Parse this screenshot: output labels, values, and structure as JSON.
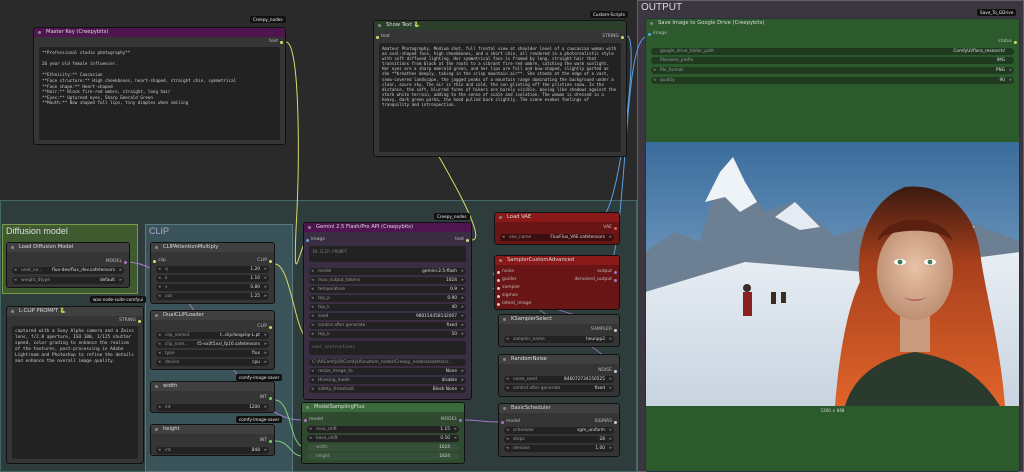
{
  "groups": {
    "output": {
      "title": "OUTPUT"
    },
    "diffusion": {
      "title": "Diffusion model"
    },
    "clip": {
      "title": "CLIP"
    }
  },
  "nodes": {
    "master_key": {
      "title": "Master Key (Creepybits)",
      "badge": "Creepy_nodes",
      "out_label": "text",
      "text": "**Professional studio photography**\n\n26 year old female influencer.\n\n**Ethnicity:** Caucasian\n**Face structure:** High cheekbones, heart-shaped, straight chin, symmetrical\n**Face shape:** Heart-shaped\n**Hair:** Black fire-red ombre, straight, long hair\n**Eyes:** Upturned eyes, Sharp Emerald Green\n**Mouth:** Bow shaped full lips, tiny dimples when smiling"
    },
    "show_text": {
      "title": "Show Text 🐍",
      "badge": "Custom-Scripts",
      "in_label": "text",
      "out_label": "STRING",
      "text": "Amateur Photography, Medium shot, full frontal view at shoulder level of a caucasian woman with an oval-shaped face, high cheekbones, and a short chin, all rendered in a photorealistic style with soft diffused lighting. Her symmetrical face is framed by long, straight hair that transitions from black at the roots to a vibrant fire-red ombre, catching the warm sunlight. Her eyes are a sharp emerald green, and her lips are full and bow-shaped, slightly parted as she **breathes deeply, taking in the crisp mountain air**. She stands at the edge of a vast, snow-covered landscape, the jagged peaks of a mountain range dominating the background under a clear, azure sky. The air is thin and cold, the sun glinting off the pristine snow. In the distance, the soft, blurred forms of hikers are barely visible, moving like shadows against the stark white terrain, adding to the sense of scale and isolation. The woman is dressed in a heavy, dark green parka, the hood pulled back slightly. The scene evokes feelings of tranquility and introspection."
    },
    "save_gdrive": {
      "title": "Save Image to Google Drive (Creepybits)",
      "badge": "Save_To_GDrive",
      "in_label": "image",
      "out_label": "status",
      "widgets": [
        {
          "label": "google_drive_folder_path",
          "value": "ComfyUI/flora_research/"
        },
        {
          "label": "filename_prefix",
          "value": "IMG"
        },
        {
          "label": "file_format",
          "value": "PNG"
        },
        {
          "label": "quality",
          "value": "90"
        }
      ],
      "caption": "1200 × 848"
    },
    "load_diffusion": {
      "title": "Load Diffusion Model",
      "badge": "was-node-suite-comfyui",
      "out_label": "MODEL",
      "widgets": [
        {
          "label": "unet_na...",
          "value": "flux-dev/flux_dev.safetensors"
        },
        {
          "label": "weight_dtype",
          "value": "default"
        }
      ]
    },
    "lclip": {
      "title": "L-CLIP PROMPT 🐍",
      "out_label": "STRING",
      "text": "captured with a Sony Alpha camera and a Zeiss lens, f/2.8 aperture, ISO 100, 1/125 shutter speed, color grading to enhance the realism of the textures, post-processing in Adobe Lightroom and Photoshop to refine the details and enhance the overall image quality."
    },
    "clip_attention": {
      "title": "CLIPAttentionMultiply",
      "in_label": "clip",
      "out_label": "CLIP",
      "widgets": [
        {
          "label": "q",
          "value": "1.20"
        },
        {
          "label": "k",
          "value": "1.10"
        },
        {
          "label": "v",
          "value": "0.80"
        },
        {
          "label": "out",
          "value": "1.25"
        }
      ]
    },
    "dualclip": {
      "title": "DualCLIPLoader",
      "badge": "comfy-image-saver",
      "out_label": "CLIP",
      "widgets": [
        {
          "label": "clip_name1",
          "value": "t..clip/longclip-L.pt"
        },
        {
          "label": "clip_nam...",
          "value": "t5-xxl/t5xxl_fp16.safetensors"
        },
        {
          "label": "type",
          "value": "flux"
        },
        {
          "label": "device",
          "value": "cpu"
        }
      ]
    },
    "width": {
      "title": "width",
      "badge": "comfy-image-saver",
      "out_label": "INT",
      "widgets": [
        {
          "label": "int",
          "value": "1200"
        }
      ]
    },
    "height": {
      "title": "height",
      "out_label": "INT",
      "widgets": [
        {
          "label": "int",
          "value": "848"
        }
      ]
    },
    "gemini": {
      "title": "Gemini 2.5 Flash/Pro API (Creepybits)",
      "badge": "Creepy_nodes",
      "in_label": "image",
      "out_label": "text",
      "input_text": "IN.CLIP.PROMPT",
      "widgets": [
        {
          "label": "model",
          "value": "gemini-2.5-flash"
        },
        {
          "label": "max_output_tokens",
          "value": "1024"
        },
        {
          "label": "temperature",
          "value": "0.9"
        },
        {
          "label": "top_p",
          "value": "0.90"
        },
        {
          "label": "top_k",
          "value": "40"
        },
        {
          "label": "seed",
          "value": "980154458142007"
        },
        {
          "label": "control after generate",
          "value": "fixed"
        },
        {
          "label": "top_k",
          "value": "50"
        }
      ],
      "user_instruction": "user_instructions",
      "path_value": "C:\\AI\\ComfyUI\\ComfyUI\\custom_nodes\\Creepy_nodes\\assets\\scr...",
      "widgets2": [
        {
          "label": "resize_image_to",
          "value": "None"
        },
        {
          "label": "thinking_mode",
          "value": "disable"
        },
        {
          "label": "safety_threshold",
          "value": "Block None"
        }
      ]
    },
    "model_sampling": {
      "title": "ModelSamplingFlux",
      "in_label": "model",
      "out_label": "MODEL",
      "widgets": [
        {
          "label": "max_shift",
          "value": "1.15"
        },
        {
          "label": "base_shift",
          "value": "0.50"
        },
        {
          "label": "width",
          "value": "1024"
        },
        {
          "label": "height",
          "value": "1024"
        }
      ]
    },
    "load_vae": {
      "title": "Load VAE",
      "out_label": "VAE",
      "widgets": [
        {
          "label": "vae_name",
          "value": "FluxFlux_VAE.safetensors"
        }
      ]
    },
    "sampler_custom": {
      "title": "SamplerCustomAdvanced",
      "outs": [
        "output",
        "denoised_output"
      ],
      "ins": [
        "noise",
        "guider",
        "sampler",
        "sigmas",
        "latent_image"
      ]
    },
    "ksampler_select": {
      "title": "KSamplerSelect",
      "out_label": "SAMPLER",
      "widgets": [
        {
          "label": "sampler_name",
          "value": "heunpp2"
        }
      ]
    },
    "random_noise": {
      "title": "RandomNoise",
      "out_label": "NOISE",
      "widgets": [
        {
          "label": "noise_seed",
          "value": "846072734150525"
        },
        {
          "label": "control after generate",
          "value": "fixed"
        }
      ]
    },
    "basic_scheduler": {
      "title": "BasicScheduler",
      "in_label": "model",
      "out_label": "SIGMAS",
      "widgets": [
        {
          "label": "scheduler",
          "value": "sgm_uniform"
        },
        {
          "label": "steps",
          "value": "28"
        },
        {
          "label": "denoise",
          "value": "1.00"
        }
      ]
    }
  },
  "colors": {
    "link_yellow": "#d8d86a",
    "link_purple": "#a278c8",
    "link_green": "#7fcf7f",
    "link_blue": "#5aa0e0"
  }
}
